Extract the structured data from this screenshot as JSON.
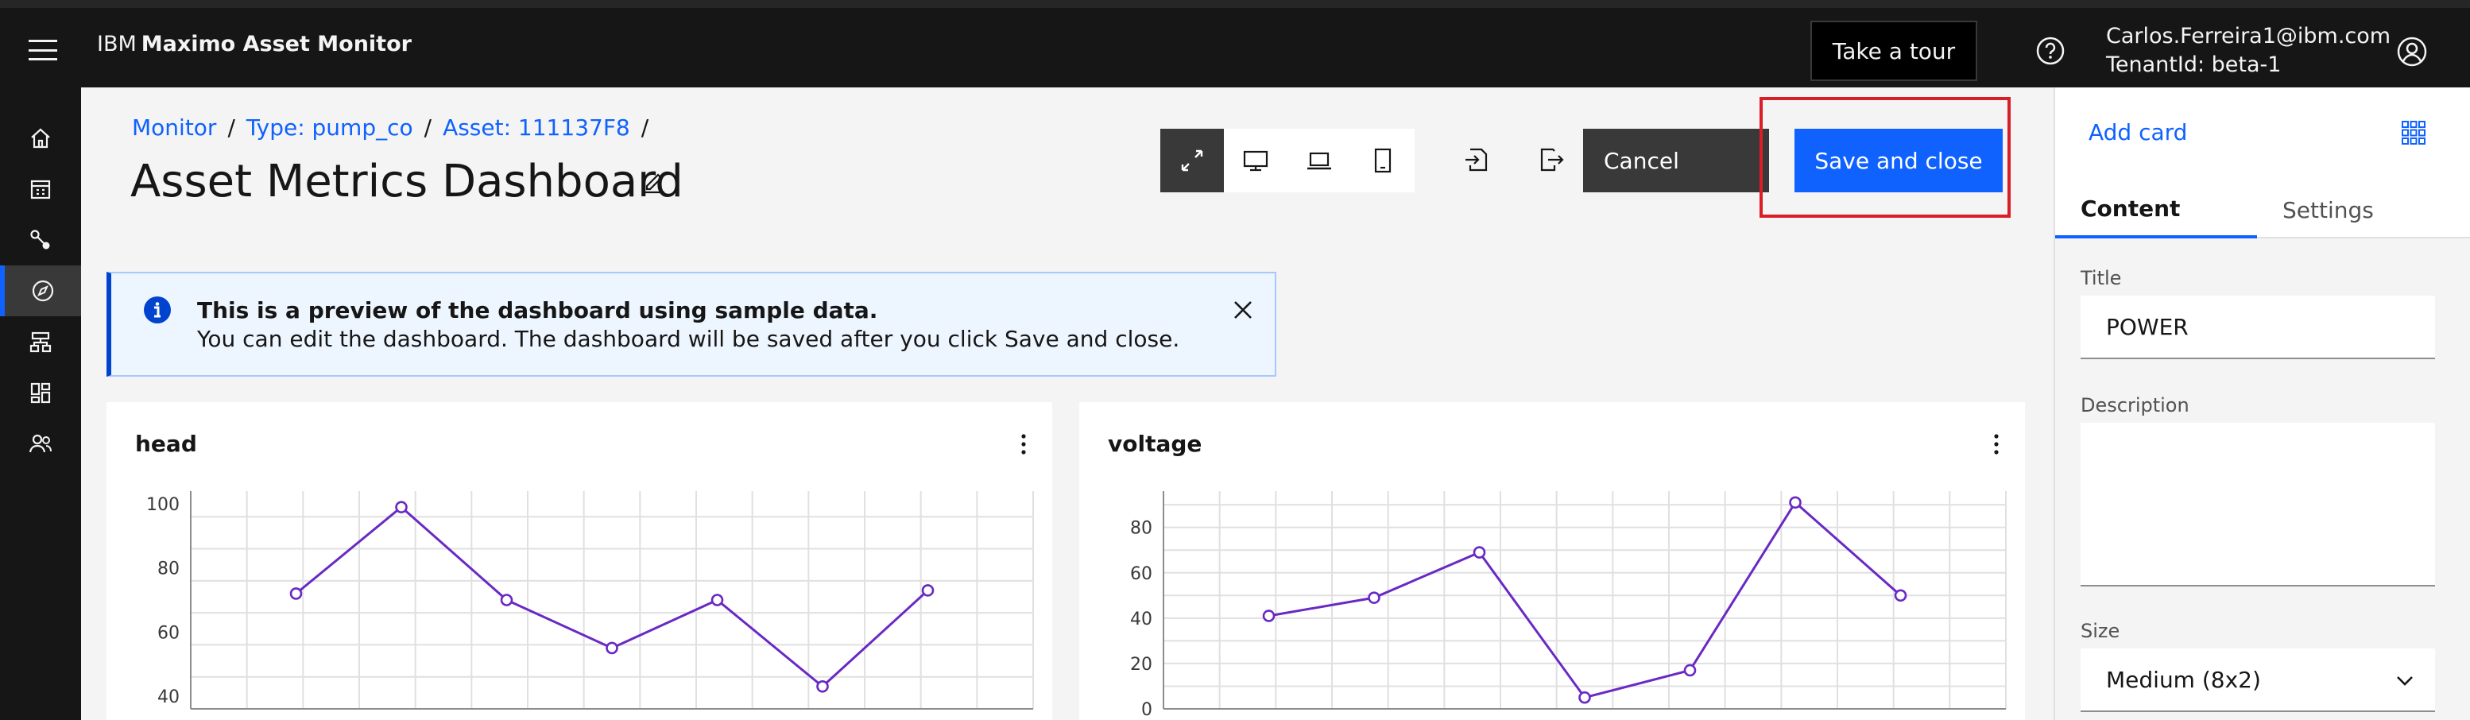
{
  "header": {
    "brand": "IBM",
    "product": "Maximo Asset Monitor",
    "tour_label": "Take a tour",
    "user_email": "Carlos.Ferreira1@ibm.com",
    "tenant": "TenantId: beta-1"
  },
  "rail": {
    "items": [
      {
        "icon": "home-icon"
      },
      {
        "icon": "calendar-icon"
      },
      {
        "icon": "connect-icon"
      },
      {
        "icon": "compass-icon",
        "active": true
      },
      {
        "icon": "hierarchy-icon"
      },
      {
        "icon": "dashboard-icon"
      },
      {
        "icon": "user-admin-icon"
      }
    ]
  },
  "breadcrumb": {
    "items": [
      "Monitor",
      "Type: pump_co",
      "Asset: 111137F8"
    ],
    "separator": "/"
  },
  "page_title": "Asset Metrics Dashboard",
  "toolbar": {
    "views": [
      "fit-screen-icon",
      "desktop-icon",
      "laptop-icon",
      "tablet-icon"
    ],
    "import_icon": "import-icon",
    "export_icon": "export-icon",
    "cancel_label": "Cancel",
    "save_label": "Save and close"
  },
  "notification": {
    "title": "This is a preview of the dashboard using sample data.",
    "subtitle": "You can edit the dashboard. The dashboard will be saved after you click Save and close."
  },
  "cards": [
    {
      "title": "head",
      "chart_data": {
        "type": "line",
        "title": "head",
        "x_count": 7,
        "values": [
          72,
          99,
          70,
          55,
          70,
          43,
          73
        ],
        "ylim": [
          36,
          104
        ],
        "yticks": [
          40,
          60,
          80,
          100
        ],
        "grid": true,
        "line_color": "#6929c4"
      }
    },
    {
      "title": "voltage",
      "chart_data": {
        "type": "line",
        "title": "voltage",
        "x_count": 7,
        "values": [
          41,
          49,
          69,
          5,
          17,
          91,
          50
        ],
        "ylim": [
          0,
          96
        ],
        "yticks": [
          0,
          20,
          40,
          60,
          80
        ],
        "grid": true,
        "line_color": "#6929c4"
      }
    }
  ],
  "panel": {
    "add_card_label": "Add card",
    "tabs": [
      "Content",
      "Settings"
    ],
    "title_label": "Title",
    "title_value": "POWER",
    "description_label": "Description",
    "size_label": "Size",
    "size_value": "Medium (8x2)"
  },
  "colors": {
    "accent": "#0f62fe",
    "highlight": "#da1e28",
    "series": "#6929c4"
  }
}
